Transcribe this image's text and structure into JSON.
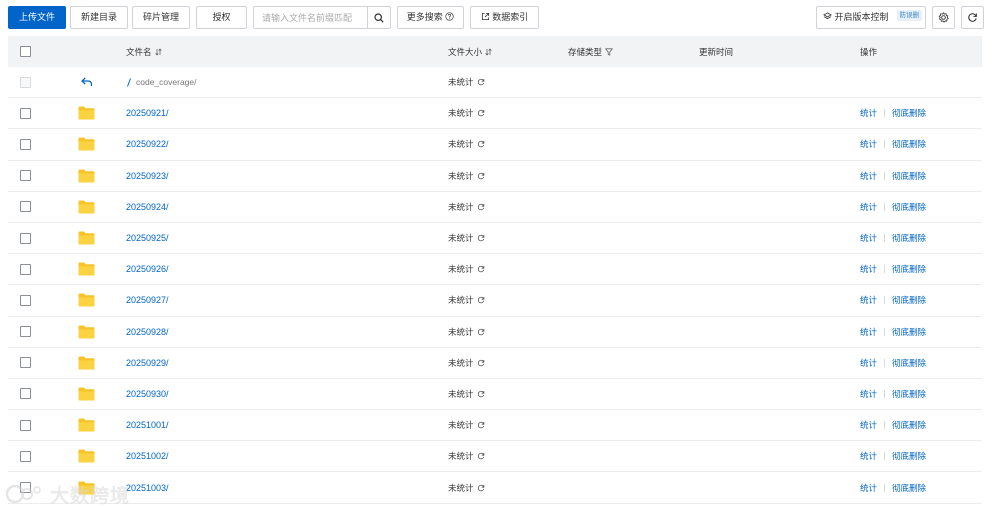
{
  "toolbar": {
    "upload_label": "上传文件",
    "new_dir_label": "新建目录",
    "fragments_label": "碎片管理",
    "authorize_label": "授权",
    "search_placeholder": "请输入文件名前缀匹配",
    "more_search_label": "更多搜索",
    "data_index_label": "数据索引",
    "version_control_label": "开启版本控制",
    "version_badge": "防误删",
    "settings_icon": "gear-icon",
    "refresh_icon": "refresh-icon"
  },
  "table": {
    "headers": {
      "name": "文件名",
      "size": "文件大小",
      "storage_type": "存储类型",
      "update_time": "更新时间",
      "actions": "操作"
    },
    "parent_row": {
      "name": "code_coverage/",
      "size": "未统计"
    },
    "rows": [
      {
        "name": "20250921/",
        "size": "未统计"
      },
      {
        "name": "20250922/",
        "size": "未统计"
      },
      {
        "name": "20250923/",
        "size": "未统计"
      },
      {
        "name": "20250924/",
        "size": "未统计"
      },
      {
        "name": "20250925/",
        "size": "未统计"
      },
      {
        "name": "20250926/",
        "size": "未统计"
      },
      {
        "name": "20250927/",
        "size": "未统计"
      },
      {
        "name": "20250928/",
        "size": "未统计"
      },
      {
        "name": "20250929/",
        "size": "未统计"
      },
      {
        "name": "20250930/",
        "size": "未统计"
      },
      {
        "name": "20251001/",
        "size": "未统计"
      },
      {
        "name": "20251002/",
        "size": "未统计"
      },
      {
        "name": "20251003/",
        "size": "未统计"
      }
    ],
    "actions": {
      "stats_label": "统计",
      "delete_label": "彻底删除"
    }
  },
  "colors": {
    "primary": "#0064c8",
    "folder": "#f7c325",
    "header_bg": "#f2f3f5"
  },
  "watermark": {
    "text": "大数跨境"
  }
}
